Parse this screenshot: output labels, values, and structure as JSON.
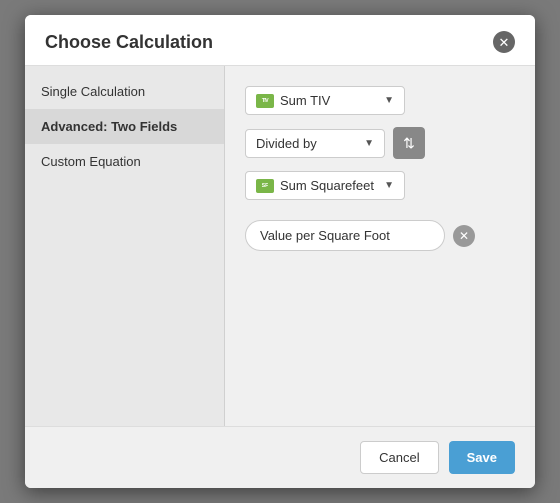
{
  "dialog": {
    "title": "Choose Calculation",
    "close_label": "✕"
  },
  "sidebar": {
    "items": [
      {
        "label": "Single Calculation",
        "active": false
      },
      {
        "label": "Advanced: Two Fields",
        "active": true
      },
      {
        "label": "Custom Equation",
        "active": false
      }
    ]
  },
  "main": {
    "field1": {
      "icon": "sum-tiv-icon",
      "label": "Sum TIV",
      "dropdown_arrow": "▼"
    },
    "operator": {
      "label": "Divided by",
      "dropdown_arrow": "▼",
      "swap_icon": "⇅"
    },
    "field2": {
      "icon": "sum-squarefeet-icon",
      "label": "Sum Squarefeet",
      "dropdown_arrow": "▼"
    },
    "result": {
      "value": "Value per Square Foot",
      "placeholder": "Value per Square Foot",
      "clear_icon": "✕"
    }
  },
  "footer": {
    "cancel_label": "Cancel",
    "save_label": "Save"
  }
}
